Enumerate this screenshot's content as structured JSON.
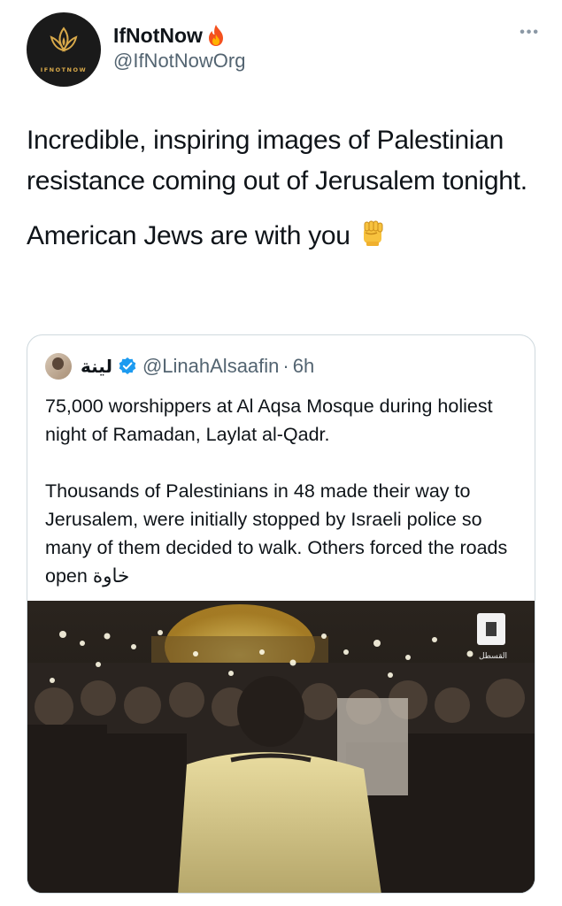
{
  "author": {
    "display_name": "IfNotNow",
    "name_emoji": "fire-icon",
    "handle": "@IfNotNowOrg",
    "avatar_text": "IFNOTNOW",
    "avatar_bg": "#1a1a1a",
    "avatar_accent": "#d8a94a"
  },
  "more_label": "•••",
  "tweet": {
    "line1": "Incredible, inspiring images of Palestinian resistance coming out of Jerusalem tonight.",
    "line2": "American Jews are with you",
    "line2_emoji": "raised-fist-icon"
  },
  "quoted": {
    "display_name": "لينة",
    "verified": true,
    "handle": "@LinahAlsaafin",
    "separator": "·",
    "time": "6h",
    "paragraph1": "75,000 worshippers at Al Aqsa Mosque during holiest night of Ramadan, Laylat al-Qadr.",
    "paragraph2": "Thousands of Palestinians in 48 made their way to Jerusalem, were initially stopped by Israeli police so many of them decided to walk. Others forced the roads open خاوة",
    "media_watermark": "القسطل"
  },
  "colors": {
    "text": "#0f1419",
    "secondary": "#536471",
    "border": "#cfd9de",
    "verified": "#1d9bf0"
  }
}
